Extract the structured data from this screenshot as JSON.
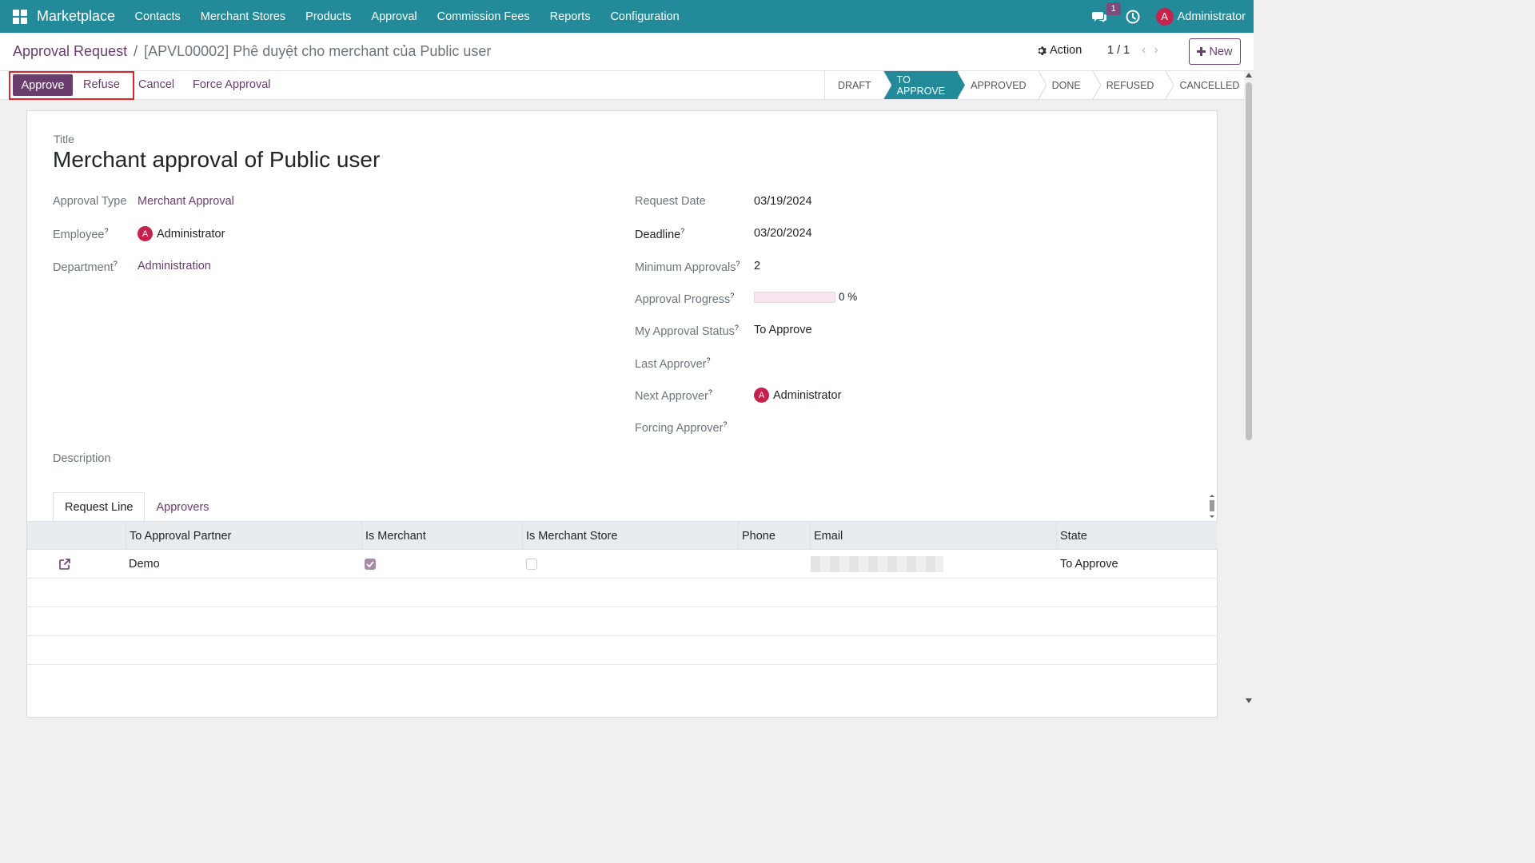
{
  "nav": {
    "brand": "Marketplace",
    "menu": [
      "Contacts",
      "Merchant Stores",
      "Products",
      "Approval",
      "Commission Fees",
      "Reports",
      "Configuration"
    ],
    "chat_badge": "1",
    "user_initial": "A",
    "user_name": "Administrator"
  },
  "breadcrumb": {
    "parent": "Approval Request",
    "separator": "/",
    "current": "[APVL00002] Phê duyệt cho merchant của Public user"
  },
  "controls": {
    "action_label": "Action",
    "pager": "1 / 1",
    "new_label": "New"
  },
  "buttons": {
    "approve": "Approve",
    "refuse": "Refuse",
    "cancel": "Cancel",
    "force_approval": "Force Approval"
  },
  "stages": [
    "DRAFT",
    "TO APPROVE",
    "APPROVED",
    "DONE",
    "REFUSED",
    "CANCELLED"
  ],
  "active_stage": "TO APPROVE",
  "form": {
    "title_label": "Title",
    "title": "Merchant approval of Public user",
    "approval_type_label": "Approval Type",
    "approval_type": "Merchant Approval",
    "employee_label": "Employee",
    "employee_initial": "A",
    "employee": "Administrator",
    "department_label": "Department",
    "department": "Administration",
    "request_date_label": "Request Date",
    "request_date": "03/19/2024",
    "deadline_label": "Deadline",
    "deadline": "03/20/2024",
    "min_approvals_label": "Minimum Approvals",
    "min_approvals": "2",
    "progress_label": "Approval Progress",
    "progress_value": 0,
    "progress_text": "0 %",
    "my_status_label": "My Approval Status",
    "my_status": "To Approve",
    "last_approver_label": "Last Approver",
    "next_approver_label": "Next Approver",
    "next_approver_initial": "A",
    "next_approver": "Administrator",
    "forcing_approver_label": "Forcing Approver",
    "description_label": "Description",
    "help_mark": "?"
  },
  "tabs": [
    "Request Line",
    "Approvers"
  ],
  "table": {
    "columns": [
      "To Approval Partner",
      "Is Merchant",
      "Is Merchant Store",
      "Phone",
      "Email",
      "State"
    ],
    "rows": [
      {
        "partner": "Demo",
        "is_merchant": true,
        "is_merchant_store": false,
        "phone": "",
        "state": "To Approve"
      }
    ]
  },
  "colors": {
    "navbar": "#228a99",
    "primary": "#6b3c6e",
    "active_stage": "#228a99",
    "avatar": "#c7224d",
    "highlight": "#e0242a"
  }
}
